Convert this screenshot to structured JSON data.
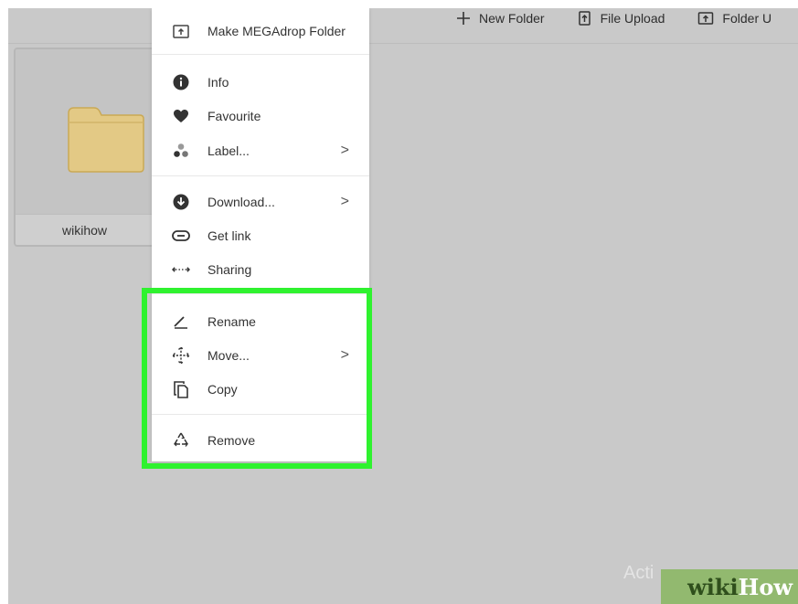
{
  "toolbar": {
    "new_folder": "New Folder",
    "file_upload": "File Upload",
    "folder_upload": "Folder U"
  },
  "folder": {
    "name": "wikihow"
  },
  "context_menu": {
    "make_megadrop": "Make MEGAdrop Folder",
    "info": "Info",
    "favourite": "Favourite",
    "label": "Label...",
    "download": "Download...",
    "get_link": "Get link",
    "sharing": "Sharing",
    "rename": "Rename",
    "move": "Move...",
    "copy": "Copy",
    "remove": "Remove",
    "submenu_glyph": ">"
  },
  "watermark": {
    "activate": "Acti",
    "wiki": "wiki",
    "how": "How"
  },
  "colors": {
    "highlight": "#2ff22f",
    "folder": "#e3c985",
    "background": "#c9c9c9"
  }
}
